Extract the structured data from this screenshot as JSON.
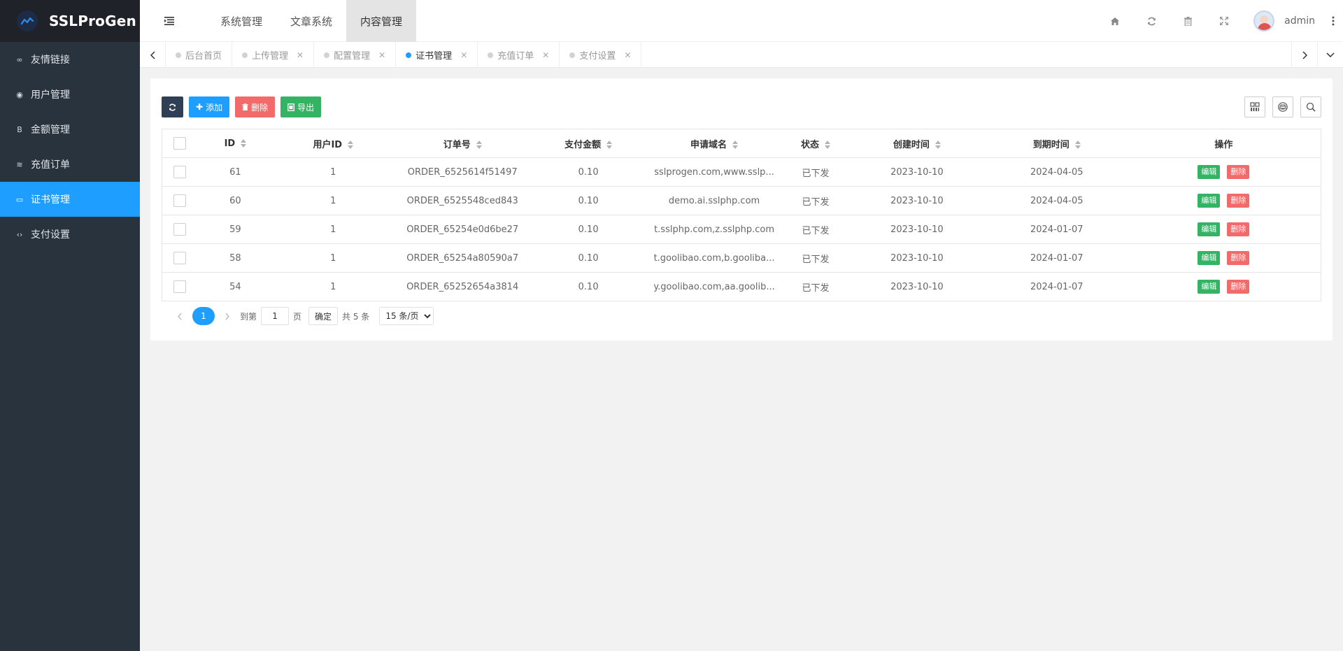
{
  "app": {
    "title": "SSLProGen"
  },
  "sidebar": {
    "items": [
      {
        "label": "友情链接",
        "icon": "link-icon",
        "glyph": "∞"
      },
      {
        "label": "用户管理",
        "icon": "user-circle-icon",
        "glyph": "◉"
      },
      {
        "label": "金额管理",
        "icon": "bitcoin-icon",
        "glyph": "B"
      },
      {
        "label": "充值订单",
        "icon": "database-icon",
        "glyph": "≋"
      },
      {
        "label": "证书管理",
        "icon": "keyboard-icon",
        "glyph": "▭",
        "active": true
      },
      {
        "label": "支付设置",
        "icon": "code-icon",
        "glyph": "‹›"
      }
    ]
  },
  "header": {
    "menu": [
      "系统管理",
      "文章系统",
      "内容管理"
    ],
    "active_menu": "内容管理",
    "username": "admin"
  },
  "tabs": [
    {
      "label": "后台首页"
    },
    {
      "label": "上传管理"
    },
    {
      "label": "配置管理"
    },
    {
      "label": "证书管理",
      "active": true
    },
    {
      "label": "充值订单"
    },
    {
      "label": "支付设置"
    }
  ],
  "toolbar": {
    "add_label": "添加",
    "delete_label": "删除",
    "export_label": "导出"
  },
  "table": {
    "columns": [
      "ID",
      "用户ID",
      "订单号",
      "支付金额",
      "申请域名",
      "状态",
      "创建时间",
      "到期时间",
      "操作"
    ],
    "rows": [
      {
        "id": "61",
        "user_id": "1",
        "order_no": "ORDER_6525614f51497",
        "amount": "0.10",
        "domain": "sslprogen.com,www.sslp...",
        "status": "已下发",
        "created": "2023-10-10",
        "expires": "2024-04-05"
      },
      {
        "id": "60",
        "user_id": "1",
        "order_no": "ORDER_6525548ced843",
        "amount": "0.10",
        "domain": "demo.ai.sslphp.com",
        "status": "已下发",
        "created": "2023-10-10",
        "expires": "2024-04-05"
      },
      {
        "id": "59",
        "user_id": "1",
        "order_no": "ORDER_65254e0d6be27",
        "amount": "0.10",
        "domain": "t.sslphp.com,z.sslphp.com",
        "status": "已下发",
        "created": "2023-10-10",
        "expires": "2024-01-07"
      },
      {
        "id": "58",
        "user_id": "1",
        "order_no": "ORDER_65254a80590a7",
        "amount": "0.10",
        "domain": "t.goolibao.com,b.gooliba...",
        "status": "已下发",
        "created": "2023-10-10",
        "expires": "2024-01-07"
      },
      {
        "id": "54",
        "user_id": "1",
        "order_no": "ORDER_65252654a3814",
        "amount": "0.10",
        "domain": "y.goolibao.com,aa.goolib...",
        "status": "已下发",
        "created": "2023-10-10",
        "expires": "2024-01-07"
      }
    ],
    "edit_label": "编辑",
    "delete_label": "删除"
  },
  "pager": {
    "current": "1",
    "goto_prefix": "到第",
    "goto_value": "1",
    "goto_suffix": "页",
    "confirm": "确定",
    "total": "共 5 条",
    "page_size": "15 条/页"
  },
  "colors": {
    "sidebar_bg": "#28333e",
    "accent": "#1e9fff",
    "success": "#34b365",
    "danger": "#f26a6a"
  }
}
